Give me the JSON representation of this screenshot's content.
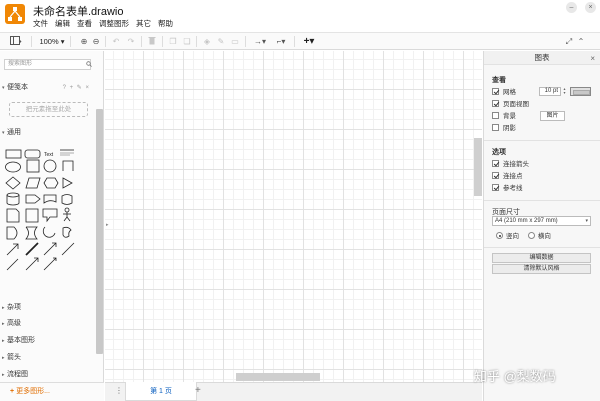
{
  "window": {
    "title": "未命名表单.drawio",
    "menu": [
      "文件",
      "编辑",
      "查看",
      "调整图形",
      "其它",
      "帮助"
    ]
  },
  "toolbar": {
    "zoom": "100%",
    "zoom_caret": "▾"
  },
  "sidebar": {
    "search_placeholder": "搜索图形",
    "notes": {
      "label": "便笺本",
      "tools": "? + ✎ ×"
    },
    "drop_hint": "把元素拖至此处",
    "general": {
      "label": "通用"
    },
    "categories": [
      "杂项",
      "高级",
      "基本图形",
      "箭头",
      "流程图"
    ],
    "more_shapes": "更多图形..."
  },
  "pages": {
    "tabs": [
      {
        "label": "第 1 页",
        "active": true
      }
    ],
    "add": "+"
  },
  "format_panel": {
    "title": "图表",
    "view": {
      "title": "查看",
      "grid": {
        "label": "网格",
        "checked": true
      },
      "grid_size": "10 pt",
      "page_view": {
        "label": "页面视图",
        "checked": true
      },
      "background": {
        "label": "背景",
        "checked": false
      },
      "image_button": "图片",
      "shadow": {
        "label": "阴影",
        "checked": false
      }
    },
    "options": {
      "title": "选项",
      "connection_arrows": {
        "label": "连接箭头",
        "checked": true
      },
      "connection_points": {
        "label": "连接点",
        "checked": true
      },
      "guides": {
        "label": "参考线",
        "checked": true
      }
    },
    "paper": {
      "title": "页面尺寸",
      "size": "A4 (210 mm x 297 mm)",
      "portrait": {
        "label": "竖向",
        "selected": true
      },
      "landscape": {
        "label": "横向",
        "selected": false
      }
    },
    "edit_data": "编辑数据",
    "clear_style": "清除默认风格"
  },
  "watermark": "知乎 @梨数码",
  "colors": {
    "accent": "#f08705",
    "link": "#0b5fbf",
    "more_shapes": "#e06d00"
  }
}
